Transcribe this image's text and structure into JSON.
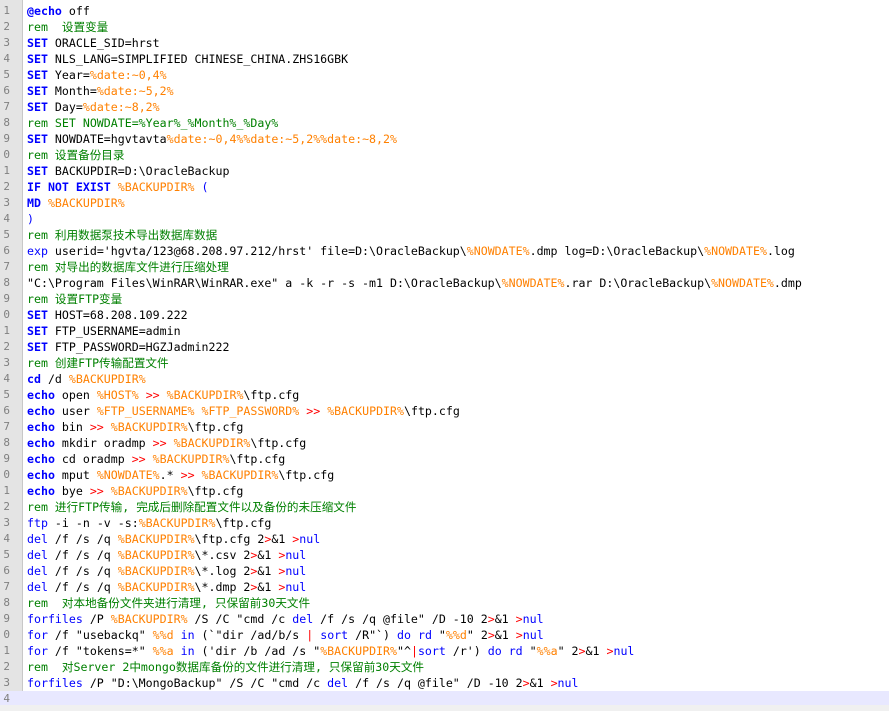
{
  "editor": {
    "lines": [
      {
        "n": "1",
        "tokens": [
          [
            "k",
            "@echo"
          ],
          [
            "t",
            " off"
          ]
        ]
      },
      {
        "n": "2",
        "tokens": [
          [
            "c",
            "rem  设置变量"
          ]
        ]
      },
      {
        "n": "3",
        "tokens": [
          [
            "k",
            "SET"
          ],
          [
            "t",
            " ORACLE_SID=hrst"
          ]
        ]
      },
      {
        "n": "4",
        "tokens": [
          [
            "k",
            "SET"
          ],
          [
            "t",
            " NLS_LANG=SIMPLIFIED CHINESE_CHINA.ZHS16GBK"
          ]
        ]
      },
      {
        "n": "5",
        "tokens": [
          [
            "k",
            "SET"
          ],
          [
            "t",
            " Year="
          ],
          [
            "v",
            "%date:~0,4%"
          ]
        ]
      },
      {
        "n": "6",
        "tokens": [
          [
            "k",
            "SET"
          ],
          [
            "t",
            " Month="
          ],
          [
            "v",
            "%date:~5,2%"
          ]
        ]
      },
      {
        "n": "7",
        "tokens": [
          [
            "k",
            "SET"
          ],
          [
            "t",
            " Day="
          ],
          [
            "v",
            "%date:~8,2%"
          ]
        ]
      },
      {
        "n": "8",
        "tokens": [
          [
            "c",
            "rem SET NOWDATE=%Year%_%Month%_%Day%"
          ]
        ]
      },
      {
        "n": "9",
        "tokens": [
          [
            "k",
            "SET"
          ],
          [
            "t",
            " NOWDATE=hgvtavta"
          ],
          [
            "v",
            "%date:~0,4%%date:~5,2%%date:~8,2%"
          ]
        ]
      },
      {
        "n": "0",
        "tokens": [
          [
            "c",
            "rem 设置备份目录"
          ]
        ]
      },
      {
        "n": "1",
        "tokens": [
          [
            "k",
            "SET"
          ],
          [
            "t",
            " BACKUPDIR=D:\\OracleBackup"
          ]
        ]
      },
      {
        "n": "2",
        "tokens": [
          [
            "k",
            "IF NOT EXIST"
          ],
          [
            "t",
            " "
          ],
          [
            "v",
            "%BACKUPDIR%"
          ],
          [
            "kn",
            " ("
          ]
        ]
      },
      {
        "n": "3",
        "tokens": [
          [
            "k",
            "MD"
          ],
          [
            "t",
            " "
          ],
          [
            "v",
            "%BACKUPDIR%"
          ]
        ]
      },
      {
        "n": "4",
        "tokens": [
          [
            "kn",
            ")"
          ]
        ]
      },
      {
        "n": "5",
        "tokens": [
          [
            "c",
            "rem 利用数据泵技术导出数据库数据"
          ]
        ]
      },
      {
        "n": "6",
        "tokens": [
          [
            "kn",
            "exp"
          ],
          [
            "t",
            " userid='hgvta/123@68.208.97.212/hrst' file=D:\\OracleBackup\\"
          ],
          [
            "v",
            "%NOWDATE%"
          ],
          [
            "t",
            ".dmp log=D:\\OracleBackup\\"
          ],
          [
            "v",
            "%NOWDATE%"
          ],
          [
            "t",
            ".log"
          ]
        ]
      },
      {
        "n": "7",
        "tokens": [
          [
            "c",
            "rem 对导出的数据库文件进行压缩处理"
          ]
        ]
      },
      {
        "n": "8",
        "tokens": [
          [
            "t",
            "\"C:\\Program Files\\WinRAR\\WinRAR.exe\" a -k -r -s -m1 D:\\OracleBackup\\"
          ],
          [
            "v",
            "%NOWDATE%"
          ],
          [
            "t",
            ".rar D:\\OracleBackup\\"
          ],
          [
            "v",
            "%NOWDATE%"
          ],
          [
            "t",
            ".dmp"
          ]
        ]
      },
      {
        "n": "9",
        "tokens": [
          [
            "c",
            "rem 设置FTP变量"
          ]
        ]
      },
      {
        "n": "0",
        "tokens": [
          [
            "k",
            "SET"
          ],
          [
            "t",
            " HOST=68.208.109.222"
          ]
        ]
      },
      {
        "n": "1",
        "tokens": [
          [
            "k",
            "SET"
          ],
          [
            "t",
            " FTP_USERNAME=admin"
          ]
        ]
      },
      {
        "n": "2",
        "tokens": [
          [
            "k",
            "SET"
          ],
          [
            "t",
            " FTP_PASSWORD=HGZJadmin222"
          ]
        ]
      },
      {
        "n": "3",
        "tokens": [
          [
            "c",
            "rem 创建FTP传输配置文件"
          ]
        ]
      },
      {
        "n": "4",
        "tokens": [
          [
            "k",
            "cd"
          ],
          [
            "t",
            " /d "
          ],
          [
            "v",
            "%BACKUPDIR%"
          ]
        ]
      },
      {
        "n": "5",
        "tokens": [
          [
            "k",
            "echo"
          ],
          [
            "t",
            " open "
          ],
          [
            "v",
            "%HOST%"
          ],
          [
            "t",
            " "
          ],
          [
            "o",
            ">>"
          ],
          [
            "t",
            " "
          ],
          [
            "v",
            "%BACKUPDIR%"
          ],
          [
            "t",
            "\\ftp.cfg"
          ]
        ]
      },
      {
        "n": "6",
        "tokens": [
          [
            "k",
            "echo"
          ],
          [
            "t",
            " user "
          ],
          [
            "v",
            "%FTP_USERNAME%"
          ],
          [
            "t",
            " "
          ],
          [
            "v",
            "%FTP_PASSWORD%"
          ],
          [
            "t",
            " "
          ],
          [
            "o",
            ">>"
          ],
          [
            "t",
            " "
          ],
          [
            "v",
            "%BACKUPDIR%"
          ],
          [
            "t",
            "\\ftp.cfg"
          ]
        ]
      },
      {
        "n": "7",
        "tokens": [
          [
            "k",
            "echo"
          ],
          [
            "t",
            " bin "
          ],
          [
            "o",
            ">>"
          ],
          [
            "t",
            " "
          ],
          [
            "v",
            "%BACKUPDIR%"
          ],
          [
            "t",
            "\\ftp.cfg"
          ]
        ]
      },
      {
        "n": "8",
        "tokens": [
          [
            "k",
            "echo"
          ],
          [
            "t",
            " mkdir oradmp "
          ],
          [
            "o",
            ">>"
          ],
          [
            "t",
            " "
          ],
          [
            "v",
            "%BACKUPDIR%"
          ],
          [
            "t",
            "\\ftp.cfg"
          ]
        ]
      },
      {
        "n": "9",
        "tokens": [
          [
            "k",
            "echo"
          ],
          [
            "t",
            " cd oradmp "
          ],
          [
            "o",
            ">>"
          ],
          [
            "t",
            " "
          ],
          [
            "v",
            "%BACKUPDIR%"
          ],
          [
            "t",
            "\\ftp.cfg"
          ]
        ]
      },
      {
        "n": "0",
        "tokens": [
          [
            "k",
            "echo"
          ],
          [
            "t",
            " mput "
          ],
          [
            "v",
            "%NOWDATE%"
          ],
          [
            "t",
            ".* "
          ],
          [
            "o",
            ">>"
          ],
          [
            "t",
            " "
          ],
          [
            "v",
            "%BACKUPDIR%"
          ],
          [
            "t",
            "\\ftp.cfg"
          ]
        ]
      },
      {
        "n": "1",
        "tokens": [
          [
            "k",
            "echo"
          ],
          [
            "t",
            " bye "
          ],
          [
            "o",
            ">>"
          ],
          [
            "t",
            " "
          ],
          [
            "v",
            "%BACKUPDIR%"
          ],
          [
            "t",
            "\\ftp.cfg"
          ]
        ]
      },
      {
        "n": "2",
        "tokens": [
          [
            "c",
            "rem 进行FTP传输, 完成后删除配置文件以及备份的未压缩文件"
          ]
        ]
      },
      {
        "n": "3",
        "tokens": [
          [
            "kn",
            "ftp"
          ],
          [
            "t",
            " -i -n -v -s:"
          ],
          [
            "v",
            "%BACKUPDIR%"
          ],
          [
            "t",
            "\\ftp.cfg"
          ]
        ]
      },
      {
        "n": "4",
        "tokens": [
          [
            "kn",
            "del"
          ],
          [
            "t",
            " /f /s /q "
          ],
          [
            "v",
            "%BACKUPDIR%"
          ],
          [
            "t",
            "\\ftp.cfg 2"
          ],
          [
            "o",
            ">"
          ],
          [
            "t",
            "&1 "
          ],
          [
            "o",
            ">"
          ],
          [
            "kn",
            "nul"
          ]
        ]
      },
      {
        "n": "5",
        "tokens": [
          [
            "kn",
            "del"
          ],
          [
            "t",
            " /f /s /q "
          ],
          [
            "v",
            "%BACKUPDIR%"
          ],
          [
            "t",
            "\\*.csv 2"
          ],
          [
            "o",
            ">"
          ],
          [
            "t",
            "&1 "
          ],
          [
            "o",
            ">"
          ],
          [
            "kn",
            "nul"
          ]
        ]
      },
      {
        "n": "6",
        "tokens": [
          [
            "kn",
            "del"
          ],
          [
            "t",
            " /f /s /q "
          ],
          [
            "v",
            "%BACKUPDIR%"
          ],
          [
            "t",
            "\\*.log 2"
          ],
          [
            "o",
            ">"
          ],
          [
            "t",
            "&1 "
          ],
          [
            "o",
            ">"
          ],
          [
            "kn",
            "nul"
          ]
        ]
      },
      {
        "n": "7",
        "tokens": [
          [
            "kn",
            "del"
          ],
          [
            "t",
            " /f /s /q "
          ],
          [
            "v",
            "%BACKUPDIR%"
          ],
          [
            "t",
            "\\*.dmp 2"
          ],
          [
            "o",
            ">"
          ],
          [
            "t",
            "&1 "
          ],
          [
            "o",
            ">"
          ],
          [
            "kn",
            "nul"
          ]
        ]
      },
      {
        "n": "8",
        "tokens": [
          [
            "c",
            "rem  对本地备份文件夹进行清理, 只保留前30天文件"
          ]
        ]
      },
      {
        "n": "9",
        "tokens": [
          [
            "kn",
            "forfiles"
          ],
          [
            "t",
            " /P "
          ],
          [
            "v",
            "%BACKUPDIR%"
          ],
          [
            "t",
            " /S /C \"cmd /c "
          ],
          [
            "kn",
            "del"
          ],
          [
            "t",
            " /f /s /q @file\" /D -10 2"
          ],
          [
            "o",
            ">"
          ],
          [
            "t",
            "&1 "
          ],
          [
            "o",
            ">"
          ],
          [
            "kn",
            "nul"
          ]
        ]
      },
      {
        "n": "0",
        "tokens": [
          [
            "kn",
            "for"
          ],
          [
            "t",
            " /f \"usebackq\" "
          ],
          [
            "v",
            "%%d"
          ],
          [
            "t",
            " "
          ],
          [
            "kn",
            "in"
          ],
          [
            "t",
            " (`\"dir /ad/b/s "
          ],
          [
            "o",
            "|"
          ],
          [
            "t",
            " "
          ],
          [
            "kn",
            "sort"
          ],
          [
            "t",
            " /R\"`) "
          ],
          [
            "kn",
            "do"
          ],
          [
            "t",
            " "
          ],
          [
            "kn",
            "rd"
          ],
          [
            "t",
            " \""
          ],
          [
            "v",
            "%%d"
          ],
          [
            "t",
            "\" 2"
          ],
          [
            "o",
            ">"
          ],
          [
            "t",
            "&1 "
          ],
          [
            "o",
            ">"
          ],
          [
            "kn",
            "nul"
          ]
        ]
      },
      {
        "n": "1",
        "tokens": [
          [
            "kn",
            "for"
          ],
          [
            "t",
            " /f \"tokens=*\" "
          ],
          [
            "v",
            "%%a"
          ],
          [
            "t",
            " "
          ],
          [
            "kn",
            "in"
          ],
          [
            "t",
            " ('dir /b /ad /s \""
          ],
          [
            "v",
            "%BACKUPDIR%"
          ],
          [
            "t",
            "\"^"
          ],
          [
            "o",
            "|"
          ],
          [
            "kn",
            "sort"
          ],
          [
            "t",
            " /r') "
          ],
          [
            "kn",
            "do"
          ],
          [
            "t",
            " "
          ],
          [
            "kn",
            "rd"
          ],
          [
            "t",
            " \""
          ],
          [
            "v",
            "%%a"
          ],
          [
            "t",
            "\" 2"
          ],
          [
            "o",
            ">"
          ],
          [
            "t",
            "&1 "
          ],
          [
            "o",
            ">"
          ],
          [
            "kn",
            "nul"
          ]
        ]
      },
      {
        "n": "2",
        "tokens": [
          [
            "c",
            "rem  对Server 2中mongo数据库备份的文件进行清理, 只保留前30天文件"
          ]
        ]
      },
      {
        "n": "3",
        "tokens": [
          [
            "kn",
            "forfiles"
          ],
          [
            "t",
            " /P \"D:\\MongoBackup\" /S /C \"cmd /c "
          ],
          [
            "kn",
            "del"
          ],
          [
            "t",
            " /f /s /q @file\" /D -10 2"
          ],
          [
            "o",
            ">"
          ],
          [
            "t",
            "&1 "
          ],
          [
            "o",
            ">"
          ],
          [
            "kn",
            "nul"
          ]
        ]
      },
      {
        "n": "4",
        "tokens": []
      }
    ],
    "current_line_index": 43,
    "colors": {
      "keyword": "#0000ff",
      "comment": "#008000",
      "variable": "#ff8000",
      "operator": "#ff0000",
      "gutter": "#e4e4e4",
      "current_line": "#e8e8ff"
    }
  }
}
